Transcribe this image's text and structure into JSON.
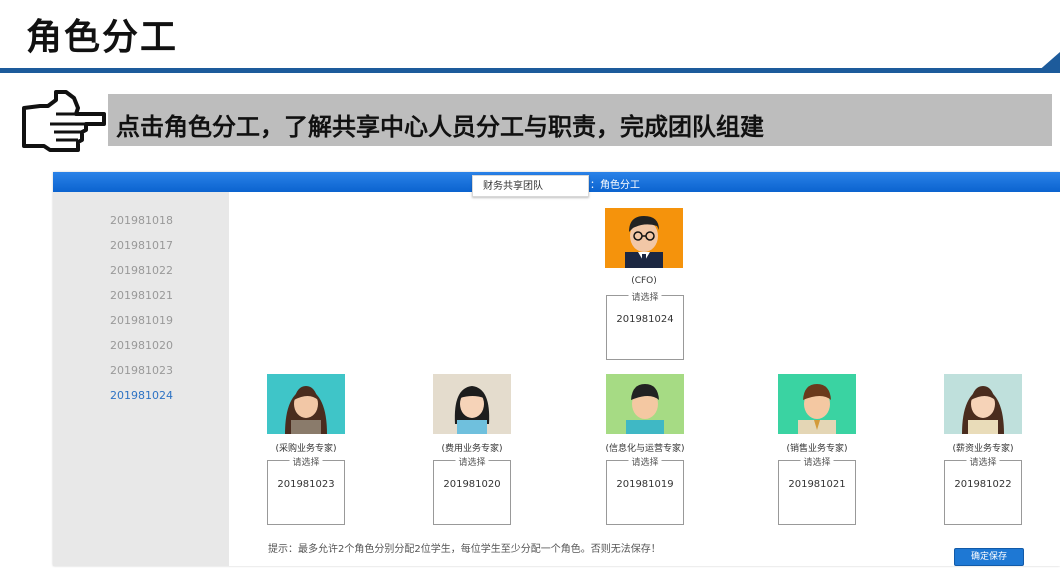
{
  "slide": {
    "title": "角色分工",
    "instruction": "点击角色分工，了解共享中心人员分工与职责，完成团队组建"
  },
  "app": {
    "team_select": "财务共享团队",
    "crumb": "：角色分工",
    "students": [
      "201981018",
      "201981017",
      "201981022",
      "201981021",
      "201981019",
      "201981020",
      "201981023",
      "201981024"
    ],
    "selected_student": "201981024",
    "placeholder": "请选择",
    "cfo": {
      "name": "(CFO)",
      "student": "201981024",
      "bg": "#f5930c"
    },
    "roles": [
      {
        "name": "(采购业务专家)",
        "student": "201981023",
        "bg": "#3fc5c8"
      },
      {
        "name": "(费用业务专家)",
        "student": "201981020",
        "bg": "#e4dccd"
      },
      {
        "name": "(信息化与运营专家)",
        "student": "201981019",
        "bg": "#a6db84"
      },
      {
        "name": "(销售业务专家)",
        "student": "201981021",
        "bg": "#3ad3a2"
      },
      {
        "name": "(薪资业务专家)",
        "student": "201981022",
        "bg": "#bfe0dc"
      }
    ],
    "hint": "提示：最多允许2个角色分别分配2位学生，每位学生至少分配一个角色。否则无法保存！",
    "save_label": "确定保存"
  }
}
